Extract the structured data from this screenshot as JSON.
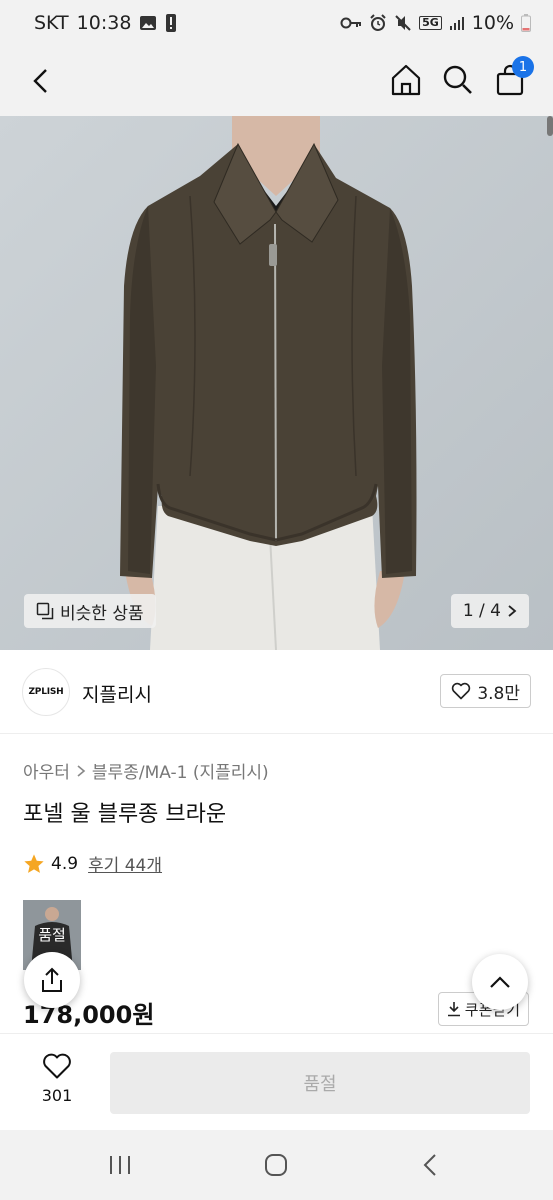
{
  "status": {
    "carrier": "SKT",
    "time": "10:38",
    "network": "5G",
    "battery": "10%"
  },
  "appbar": {
    "cart_count": "1"
  },
  "hero": {
    "similar_label": "비슷한 상품",
    "pager": "1 / 4"
  },
  "brand": {
    "logo_text": "ZPLISH",
    "name": "지플리시",
    "likes": "3.8만"
  },
  "product": {
    "breadcrumb": [
      "아우터",
      "블루종/MA-1 (지플리시)"
    ],
    "title": "포넬 울 블루종 브라운",
    "rating": "4.9",
    "reviews": "후기 44개",
    "thumb_badge": "품절",
    "price": "178,000원",
    "coupon_label": "쿠폰받기"
  },
  "bottom": {
    "wish_count": "301",
    "soldout_label": "품절"
  }
}
